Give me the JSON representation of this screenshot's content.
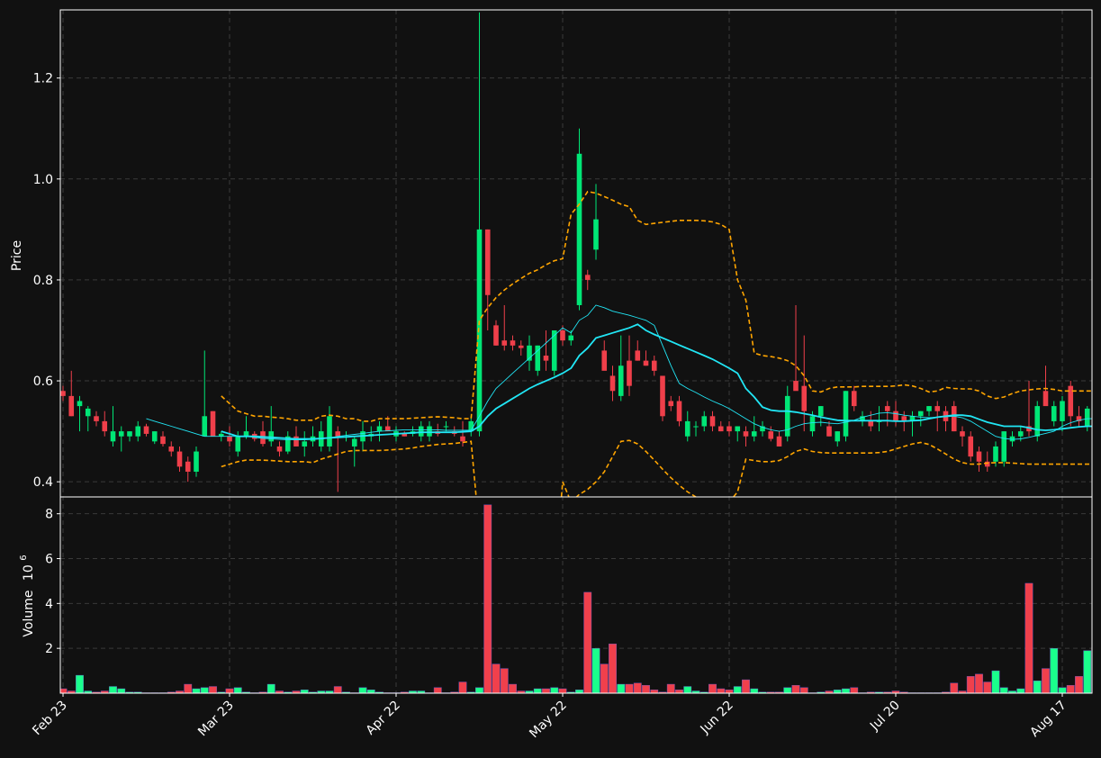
{
  "chart_data": {
    "type": "candlestick",
    "x_tick_labels": [
      "Feb 23",
      "Mar 23",
      "Apr 22",
      "May 22",
      "Jun 22",
      "Jul 20",
      "Aug 17"
    ],
    "x_tick_index": [
      0,
      20,
      40,
      60,
      80,
      100,
      120
    ],
    "price_panel": {
      "ylabel": "Price",
      "ylim": [
        0.37,
        1.335
      ],
      "yticks": [
        0.4,
        0.6,
        0.8,
        1.0,
        1.2
      ],
      "ytick_labels": [
        "0.4",
        "0.6",
        "0.8",
        "1.0",
        "1.2"
      ],
      "grid": true
    },
    "volume_panel": {
      "ylabel": "Volume",
      "ylabel_exponent": "10",
      "ylabel_exponent_power": "6",
      "ylim": [
        0,
        8.75
      ],
      "yticks": [
        2,
        4,
        6,
        8
      ],
      "ytick_labels": [
        "2",
        "4",
        "6",
        "8"
      ],
      "grid": true
    },
    "colors": {
      "background": "#111111",
      "up": "#00e676",
      "down": "#ef3f4a",
      "volume_up": "#1aff8c",
      "volume_down": "#f0404c",
      "moving_average": "#21e6f5",
      "bands": "#ffa500",
      "axes": "#ffffff",
      "grid": "#3a3a3a"
    },
    "price_ohlc": [
      [
        0.58,
        0.59,
        0.56,
        0.57
      ],
      [
        0.57,
        0.62,
        0.53,
        0.53
      ],
      [
        0.55,
        0.57,
        0.5,
        0.56
      ],
      [
        0.53,
        0.55,
        0.5,
        0.545
      ],
      [
        0.53,
        0.54,
        0.51,
        0.52
      ],
      [
        0.52,
        0.54,
        0.49,
        0.5
      ],
      [
        0.48,
        0.55,
        0.47,
        0.5
      ],
      [
        0.49,
        0.51,
        0.46,
        0.5
      ],
      [
        0.49,
        0.5,
        0.48,
        0.5
      ],
      [
        0.49,
        0.52,
        0.48,
        0.51
      ],
      [
        0.51,
        0.515,
        0.49,
        0.495
      ],
      [
        0.48,
        0.5,
        0.475,
        0.5
      ],
      [
        0.49,
        0.5,
        0.47,
        0.475
      ],
      [
        0.47,
        0.48,
        0.45,
        0.46
      ],
      [
        0.46,
        0.47,
        0.42,
        0.43
      ],
      [
        0.44,
        0.45,
        0.4,
        0.42
      ],
      [
        0.42,
        0.47,
        0.41,
        0.46
      ],
      [
        0.49,
        0.66,
        0.49,
        0.53
      ],
      [
        0.54,
        0.54,
        0.5,
        0.49
      ],
      [
        0.49,
        0.5,
        0.48,
        0.495
      ],
      [
        0.49,
        0.51,
        0.47,
        0.48
      ],
      [
        0.46,
        0.5,
        0.45,
        0.49
      ],
      [
        0.49,
        0.53,
        0.485,
        0.5
      ],
      [
        0.495,
        0.5,
        0.48,
        0.485
      ],
      [
        0.5,
        0.52,
        0.47,
        0.475
      ],
      [
        0.48,
        0.55,
        0.47,
        0.5
      ],
      [
        0.47,
        0.48,
        0.45,
        0.46
      ],
      [
        0.46,
        0.5,
        0.455,
        0.49
      ],
      [
        0.49,
        0.51,
        0.48,
        0.47
      ],
      [
        0.47,
        0.5,
        0.45,
        0.48
      ],
      [
        0.48,
        0.51,
        0.47,
        0.49
      ],
      [
        0.47,
        0.52,
        0.46,
        0.5
      ],
      [
        0.47,
        0.55,
        0.46,
        0.53
      ],
      [
        0.5,
        0.51,
        0.38,
        0.49
      ],
      [
        0.49,
        0.5,
        0.48,
        0.49
      ],
      [
        0.47,
        0.49,
        0.43,
        0.485
      ],
      [
        0.48,
        0.52,
        0.46,
        0.5
      ],
      [
        0.49,
        0.51,
        0.48,
        0.495
      ],
      [
        0.5,
        0.52,
        0.48,
        0.51
      ],
      [
        0.51,
        0.53,
        0.5,
        0.5
      ],
      [
        0.49,
        0.51,
        0.48,
        0.5
      ],
      [
        0.495,
        0.5,
        0.49,
        0.49
      ],
      [
        0.495,
        0.51,
        0.49,
        0.5
      ],
      [
        0.49,
        0.52,
        0.48,
        0.51
      ],
      [
        0.49,
        0.52,
        0.48,
        0.51
      ],
      [
        0.5,
        0.515,
        0.49,
        0.495
      ],
      [
        0.51,
        0.52,
        0.5,
        0.51
      ],
      [
        0.5,
        0.51,
        0.49,
        0.495
      ],
      [
        0.49,
        0.52,
        0.47,
        0.48
      ],
      [
        0.5,
        0.53,
        0.49,
        0.52
      ],
      [
        0.5,
        1.33,
        0.49,
        0.9
      ],
      [
        0.9,
        0.9,
        0.7,
        0.77
      ],
      [
        0.71,
        0.72,
        0.67,
        0.67
      ],
      [
        0.68,
        0.75,
        0.66,
        0.67
      ],
      [
        0.68,
        0.69,
        0.66,
        0.67
      ],
      [
        0.67,
        0.68,
        0.65,
        0.665
      ],
      [
        0.64,
        0.69,
        0.62,
        0.67
      ],
      [
        0.62,
        0.67,
        0.61,
        0.67
      ],
      [
        0.65,
        0.7,
        0.62,
        0.64
      ],
      [
        0.62,
        0.7,
        0.61,
        0.7
      ],
      [
        0.7,
        0.71,
        0.67,
        0.68
      ],
      [
        0.68,
        0.7,
        0.67,
        0.69
      ],
      [
        0.75,
        1.1,
        0.74,
        1.05
      ],
      [
        0.81,
        0.82,
        0.78,
        0.8
      ],
      [
        0.86,
        0.99,
        0.84,
        0.92
      ],
      [
        0.66,
        0.68,
        0.63,
        0.62
      ],
      [
        0.61,
        0.63,
        0.56,
        0.58
      ],
      [
        0.57,
        0.69,
        0.56,
        0.63
      ],
      [
        0.64,
        0.69,
        0.57,
        0.59
      ],
      [
        0.66,
        0.68,
        0.64,
        0.64
      ],
      [
        0.64,
        0.66,
        0.63,
        0.63
      ],
      [
        0.64,
        0.65,
        0.61,
        0.62
      ],
      [
        0.61,
        0.61,
        0.52,
        0.53
      ],
      [
        0.56,
        0.57,
        0.54,
        0.55
      ],
      [
        0.56,
        0.57,
        0.51,
        0.52
      ],
      [
        0.49,
        0.54,
        0.48,
        0.52
      ],
      [
        0.51,
        0.52,
        0.49,
        0.51
      ],
      [
        0.51,
        0.54,
        0.5,
        0.53
      ],
      [
        0.53,
        0.54,
        0.5,
        0.51
      ],
      [
        0.51,
        0.52,
        0.5,
        0.5
      ],
      [
        0.51,
        0.52,
        0.49,
        0.5
      ],
      [
        0.5,
        0.51,
        0.48,
        0.51
      ],
      [
        0.5,
        0.51,
        0.47,
        0.49
      ],
      [
        0.49,
        0.53,
        0.48,
        0.5
      ],
      [
        0.5,
        0.52,
        0.49,
        0.51
      ],
      [
        0.5,
        0.51,
        0.48,
        0.485
      ],
      [
        0.49,
        0.5,
        0.47,
        0.47
      ],
      [
        0.49,
        0.59,
        0.48,
        0.57
      ],
      [
        0.6,
        0.75,
        0.59,
        0.58
      ],
      [
        0.59,
        0.69,
        0.5,
        0.54
      ],
      [
        0.5,
        0.54,
        0.49,
        0.53
      ],
      [
        0.53,
        0.55,
        0.51,
        0.55
      ],
      [
        0.51,
        0.52,
        0.49,
        0.49
      ],
      [
        0.48,
        0.5,
        0.47,
        0.5
      ],
      [
        0.49,
        0.58,
        0.48,
        0.58
      ],
      [
        0.58,
        0.59,
        0.54,
        0.55
      ],
      [
        0.52,
        0.54,
        0.51,
        0.53
      ],
      [
        0.52,
        0.54,
        0.5,
        0.51
      ],
      [
        0.52,
        0.55,
        0.5,
        0.52
      ],
      [
        0.55,
        0.56,
        0.51,
        0.54
      ],
      [
        0.54,
        0.56,
        0.51,
        0.52
      ],
      [
        0.53,
        0.54,
        0.5,
        0.52
      ],
      [
        0.52,
        0.54,
        0.49,
        0.53
      ],
      [
        0.53,
        0.54,
        0.51,
        0.54
      ],
      [
        0.54,
        0.55,
        0.53,
        0.55
      ],
      [
        0.55,
        0.56,
        0.5,
        0.54
      ],
      [
        0.54,
        0.55,
        0.5,
        0.52
      ],
      [
        0.55,
        0.56,
        0.5,
        0.5
      ],
      [
        0.5,
        0.51,
        0.47,
        0.49
      ],
      [
        0.49,
        0.5,
        0.44,
        0.45
      ],
      [
        0.46,
        0.47,
        0.42,
        0.44
      ],
      [
        0.44,
        0.46,
        0.42,
        0.43
      ],
      [
        0.44,
        0.48,
        0.43,
        0.47
      ],
      [
        0.44,
        0.5,
        0.43,
        0.5
      ],
      [
        0.48,
        0.5,
        0.47,
        0.49
      ],
      [
        0.49,
        0.51,
        0.48,
        0.5
      ],
      [
        0.51,
        0.6,
        0.49,
        0.5
      ],
      [
        0.49,
        0.56,
        0.48,
        0.55
      ],
      [
        0.58,
        0.63,
        0.57,
        0.55
      ],
      [
        0.52,
        0.56,
        0.51,
        0.55
      ],
      [
        0.52,
        0.57,
        0.5,
        0.56
      ],
      [
        0.59,
        0.6,
        0.51,
        0.53
      ],
      [
        0.53,
        0.55,
        0.51,
        0.52
      ],
      [
        0.51,
        0.55,
        0.5,
        0.545
      ],
      [
        0.545,
        0.56,
        0.51,
        0.515
      ]
    ],
    "volume_millions": [
      0.2,
      0.1,
      0.8,
      0.1,
      0.05,
      0.1,
      0.3,
      0.2,
      0.05,
      0.05,
      0.02,
      0.02,
      0.02,
      0.05,
      0.1,
      0.4,
      0.2,
      0.25,
      0.3,
      0.05,
      0.2,
      0.25,
      0.05,
      0.02,
      0.05,
      0.4,
      0.1,
      0.05,
      0.1,
      0.15,
      0.05,
      0.1,
      0.1,
      0.3,
      0.05,
      0.02,
      0.25,
      0.15,
      0.05,
      0.02,
      0.02,
      0.05,
      0.1,
      0.1,
      0.02,
      0.25,
      0.02,
      0.05,
      0.5,
      0.05,
      0.25,
      8.4,
      1.3,
      1.1,
      0.4,
      0.1,
      0.1,
      0.2,
      0.2,
      0.25,
      0.2,
      0.05,
      0.15,
      4.5,
      2.0,
      1.3,
      2.2,
      0.4,
      0.4,
      0.45,
      0.35,
      0.15,
      0.05,
      0.4,
      0.15,
      0.3,
      0.1,
      0.05,
      0.4,
      0.2,
      0.15,
      0.3,
      0.6,
      0.2,
      0.05,
      0.05,
      0.05,
      0.25,
      0.35,
      0.25,
      0.02,
      0.05,
      0.1,
      0.15,
      0.2,
      0.25,
      0.02,
      0.05,
      0.05,
      0.05,
      0.1,
      0.05,
      0.02,
      0.02,
      0.02,
      0.02,
      0.05,
      0.45,
      0.1,
      0.75,
      0.85,
      0.5,
      1.0,
      0.25,
      0.1,
      0.2,
      4.9,
      0.55,
      1.1,
      2.0,
      0.25,
      0.35,
      0.75,
      1.9,
      0.55,
      0.15
    ],
    "moving_average_fast": [
      null,
      null,
      null,
      null,
      null,
      null,
      null,
      null,
      null,
      null,
      0.525,
      0.52,
      0.515,
      0.51,
      0.505,
      0.5,
      0.495,
      0.49,
      0.49,
      0.49,
      0.49,
      0.49,
      0.49,
      0.488,
      0.486,
      0.485,
      0.484,
      0.483,
      0.483,
      0.483,
      0.484,
      0.485,
      0.487,
      0.49,
      0.492,
      0.494,
      0.496,
      0.498,
      0.5,
      0.501,
      0.502,
      0.503,
      0.503,
      0.503,
      0.503,
      0.503,
      0.502,
      0.502,
      0.502,
      0.502,
      0.53,
      0.56,
      0.585,
      0.6,
      0.615,
      0.63,
      0.645,
      0.66,
      0.675,
      0.69,
      0.705,
      0.695,
      0.72,
      0.73,
      0.75,
      0.745,
      0.738,
      0.734,
      0.73,
      0.725,
      0.72,
      0.71,
      0.67,
      0.63,
      0.595,
      0.585,
      0.577,
      0.568,
      0.56,
      0.553,
      0.545,
      0.535,
      0.525,
      0.515,
      0.508,
      0.503,
      0.5,
      0.503,
      0.51,
      0.515,
      0.517,
      0.518,
      0.516,
      0.515,
      0.518,
      0.522,
      0.528,
      0.532,
      0.536,
      0.537,
      0.535,
      0.532,
      0.53,
      0.528,
      0.527,
      0.528,
      0.529,
      0.53,
      0.527,
      0.52,
      0.51,
      0.5,
      0.49,
      0.486,
      0.484,
      0.485,
      0.488,
      0.492,
      0.496,
      0.5,
      0.51,
      0.517,
      0.522,
      0.525,
      0.525,
      0.524
    ],
    "moving_average_slow": [
      null,
      null,
      null,
      null,
      null,
      null,
      null,
      null,
      null,
      null,
      null,
      null,
      null,
      null,
      null,
      null,
      null,
      null,
      null,
      0.5,
      0.495,
      0.49,
      0.49,
      0.49,
      0.489,
      0.488,
      0.487,
      0.486,
      0.485,
      0.485,
      0.485,
      0.486,
      0.487,
      0.488,
      0.489,
      0.49,
      0.491,
      0.492,
      0.493,
      0.494,
      0.495,
      0.496,
      0.497,
      0.498,
      0.498,
      0.498,
      0.498,
      0.498,
      0.499,
      0.5,
      0.51,
      0.53,
      0.545,
      0.555,
      0.565,
      0.575,
      0.585,
      0.593,
      0.6,
      0.607,
      0.615,
      0.625,
      0.65,
      0.665,
      0.685,
      0.69,
      0.695,
      0.7,
      0.705,
      0.712,
      0.7,
      0.692,
      0.685,
      0.678,
      0.671,
      0.664,
      0.657,
      0.65,
      0.643,
      0.634,
      0.625,
      0.615,
      0.585,
      0.568,
      0.548,
      0.542,
      0.54,
      0.54,
      0.538,
      0.535,
      0.532,
      0.528,
      0.525,
      0.522,
      0.521,
      0.521,
      0.521,
      0.521,
      0.521,
      0.521,
      0.52,
      0.52,
      0.521,
      0.522,
      0.525,
      0.528,
      0.53,
      0.532,
      0.532,
      0.53,
      0.524,
      0.518,
      0.514,
      0.51,
      0.51,
      0.51,
      0.507,
      0.503,
      0.502,
      0.503,
      0.505,
      0.507,
      0.509,
      0.51,
      0.51,
      0.509
    ],
    "band_upper": [
      null,
      null,
      null,
      null,
      null,
      null,
      null,
      null,
      null,
      null,
      null,
      null,
      null,
      null,
      null,
      null,
      null,
      null,
      null,
      0.57,
      0.555,
      0.54,
      0.535,
      0.53,
      0.53,
      0.528,
      0.527,
      0.525,
      0.522,
      0.522,
      0.522,
      0.53,
      0.532,
      0.53,
      0.525,
      0.525,
      0.52,
      0.52,
      0.525,
      0.525,
      0.525,
      0.525,
      0.526,
      0.527,
      0.528,
      0.529,
      0.528,
      0.527,
      0.525,
      0.525,
      0.72,
      0.745,
      0.765,
      0.78,
      0.792,
      0.803,
      0.813,
      0.82,
      0.83,
      0.838,
      0.842,
      0.93,
      0.95,
      0.975,
      0.972,
      0.965,
      0.958,
      0.95,
      0.945,
      0.918,
      0.91,
      0.912,
      0.914,
      0.916,
      0.918,
      0.918,
      0.918,
      0.917,
      0.915,
      0.91,
      0.9,
      0.8,
      0.76,
      0.655,
      0.65,
      0.648,
      0.645,
      0.64,
      0.63,
      0.61,
      0.58,
      0.578,
      0.585,
      0.588,
      0.588,
      0.588,
      0.589,
      0.589,
      0.589,
      0.589,
      0.59,
      0.592,
      0.59,
      0.585,
      0.578,
      0.58,
      0.587,
      0.585,
      0.584,
      0.584,
      0.58,
      0.57,
      0.565,
      0.568,
      0.575,
      0.58,
      0.582,
      0.584,
      0.585,
      0.583,
      0.58,
      0.58,
      0.58,
      0.58,
      0.58,
      0.58
    ],
    "band_lower": [
      null,
      null,
      null,
      null,
      null,
      null,
      null,
      null,
      null,
      null,
      null,
      null,
      null,
      null,
      null,
      null,
      null,
      null,
      null,
      0.43,
      0.435,
      0.44,
      0.443,
      0.443,
      0.443,
      0.442,
      0.441,
      0.44,
      0.44,
      0.44,
      0.438,
      0.445,
      0.45,
      0.455,
      0.46,
      0.462,
      0.462,
      0.462,
      0.462,
      0.463,
      0.464,
      0.465,
      0.467,
      0.47,
      0.472,
      0.474,
      0.475,
      0.476,
      0.478,
      0.48,
      0.3,
      0.26,
      0.23,
      0.21,
      0.2,
      0.19,
      0.18,
      0.18,
      0.19,
      0.2,
      0.4,
      0.36,
      0.375,
      0.385,
      0.4,
      0.42,
      0.45,
      0.48,
      0.482,
      0.475,
      0.46,
      0.443,
      0.425,
      0.408,
      0.393,
      0.38,
      0.37,
      0.36,
      0.352,
      0.345,
      0.36,
      0.38,
      0.445,
      0.442,
      0.44,
      0.44,
      0.442,
      0.45,
      0.46,
      0.465,
      0.46,
      0.458,
      0.457,
      0.457,
      0.457,
      0.457,
      0.457,
      0.457,
      0.458,
      0.46,
      0.465,
      0.47,
      0.475,
      0.478,
      0.474,
      0.465,
      0.455,
      0.445,
      0.438,
      0.435,
      0.435,
      0.437,
      0.438,
      0.438,
      0.437,
      0.436,
      0.435,
      0.435,
      0.435,
      0.435,
      0.435,
      0.435,
      0.435,
      0.435,
      0.435,
      0.435
    ]
  }
}
